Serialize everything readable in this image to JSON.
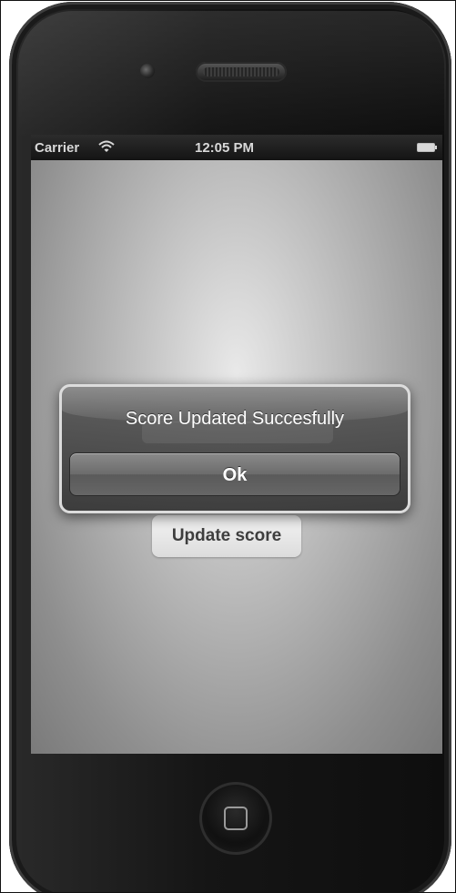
{
  "status_bar": {
    "carrier": "Carrier",
    "time": "12:05 PM",
    "wifi_icon": "wifi-icon",
    "battery_icon": "battery-icon"
  },
  "main": {
    "update_button_label": "Update score"
  },
  "alert": {
    "title": "Score Updated Succesfully",
    "ok_label": "Ok"
  },
  "device": {
    "home_icon": "home-button-icon",
    "camera_icon": "camera-icon",
    "speaker_icon": "speaker-icon"
  },
  "colors": {
    "bezel": "#151515",
    "alert_bg": "#4a4a4a",
    "screen_bg": "#bdbdbd"
  }
}
